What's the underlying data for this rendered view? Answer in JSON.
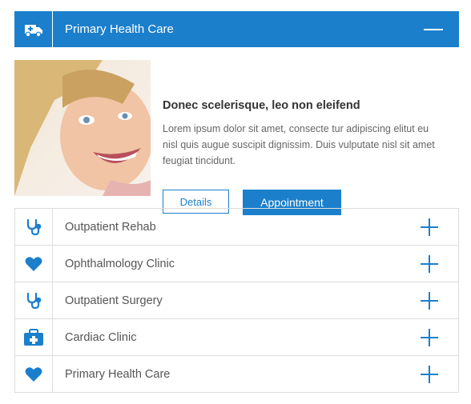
{
  "accordion": {
    "active": {
      "title": "Primary Health Care",
      "icon": "ambulance-icon",
      "heading": "Donec scelerisque, leo non eleifend",
      "text": "Lorem ipsum dolor sit amet, consecte tur adipiscing elitut eu nisl quis augue suscipit dignissim. Duis vulputate nisl sit amet feugiat tincidunt.",
      "details_label": "Details",
      "appointment_label": "Appointment"
    },
    "items": [
      {
        "label": "Outpatient Rehab",
        "icon": "stethoscope-icon"
      },
      {
        "label": "Ophthalmology Clinic",
        "icon": "heart-icon"
      },
      {
        "label": "Outpatient Surgery",
        "icon": "stethoscope-icon"
      },
      {
        "label": "Cardiac Clinic",
        "icon": "medical-kit-icon"
      },
      {
        "label": "Primary Health Care",
        "icon": "heart-icon"
      }
    ]
  },
  "colors": {
    "accent": "#1b7fcc",
    "border": "#dddddd",
    "text": "#555555"
  }
}
